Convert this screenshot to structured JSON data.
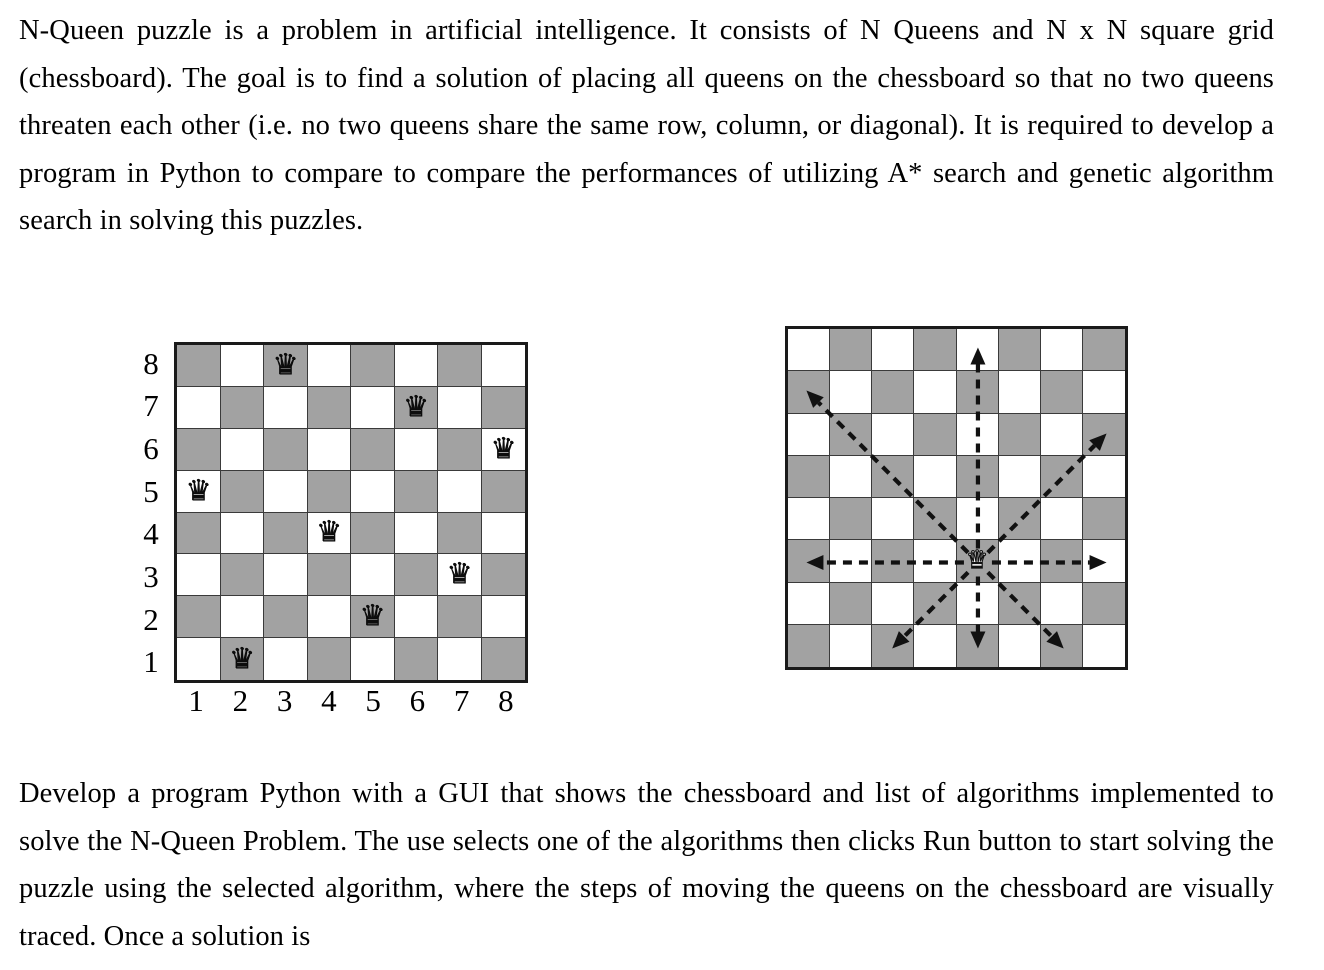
{
  "document": {
    "paragraph_top": "N-Queen puzzle is a problem in artificial intelligence. It consists of N Queens and N x N square grid (chessboard). The goal is to find a solution of placing all queens on the chessboard so that no two queens threaten each other (i.e. no two queens share the same row, column, or diagonal). It is required to develop a program in Python to compare to compare the performances of utilizing A* search and genetic algorithm search in solving this puzzles.",
    "paragraph_bottom": "Develop a program Python with a GUI that shows the chessboard and list of algorithms implemented to solve the N-Queen Problem. The use selects one of the algorithms then clicks Run button to start solving the puzzle using the selected algorithm, where the steps of moving the queens on the chessboard are visually traced. Once a solution is"
  },
  "figures": {
    "left_board": {
      "name": "eight-queens-solution-board",
      "size": 8,
      "rank_labels": [
        "8",
        "7",
        "6",
        "5",
        "4",
        "3",
        "2",
        "1"
      ],
      "file_labels": [
        "1",
        "2",
        "3",
        "4",
        "5",
        "6",
        "7",
        "8"
      ],
      "queen_glyph": "♛",
      "light_color": "#ffffff",
      "dark_color": "#a2a2a2",
      "border_color": "#1a1a1a",
      "queens": [
        {
          "file": 3,
          "rank": 8
        },
        {
          "file": 6,
          "rank": 7
        },
        {
          "file": 8,
          "rank": 6
        },
        {
          "file": 1,
          "rank": 5
        },
        {
          "file": 4,
          "rank": 4
        },
        {
          "file": 7,
          "rank": 3
        },
        {
          "file": 5,
          "rank": 2
        },
        {
          "file": 2,
          "rank": 1
        }
      ]
    },
    "right_board": {
      "name": "queen-attack-directions-board",
      "size": 8,
      "queen_glyph": "♛",
      "light_color": "#ffffff",
      "dark_color": "#a2a2a2",
      "border_color": "#1a1a1a",
      "arrow_color": "#111111",
      "queen": {
        "col": 5,
        "row": 6
      },
      "arrow_directions": [
        "up",
        "down",
        "left",
        "right",
        "up-left",
        "up-right",
        "down-left",
        "down-right"
      ]
    }
  }
}
